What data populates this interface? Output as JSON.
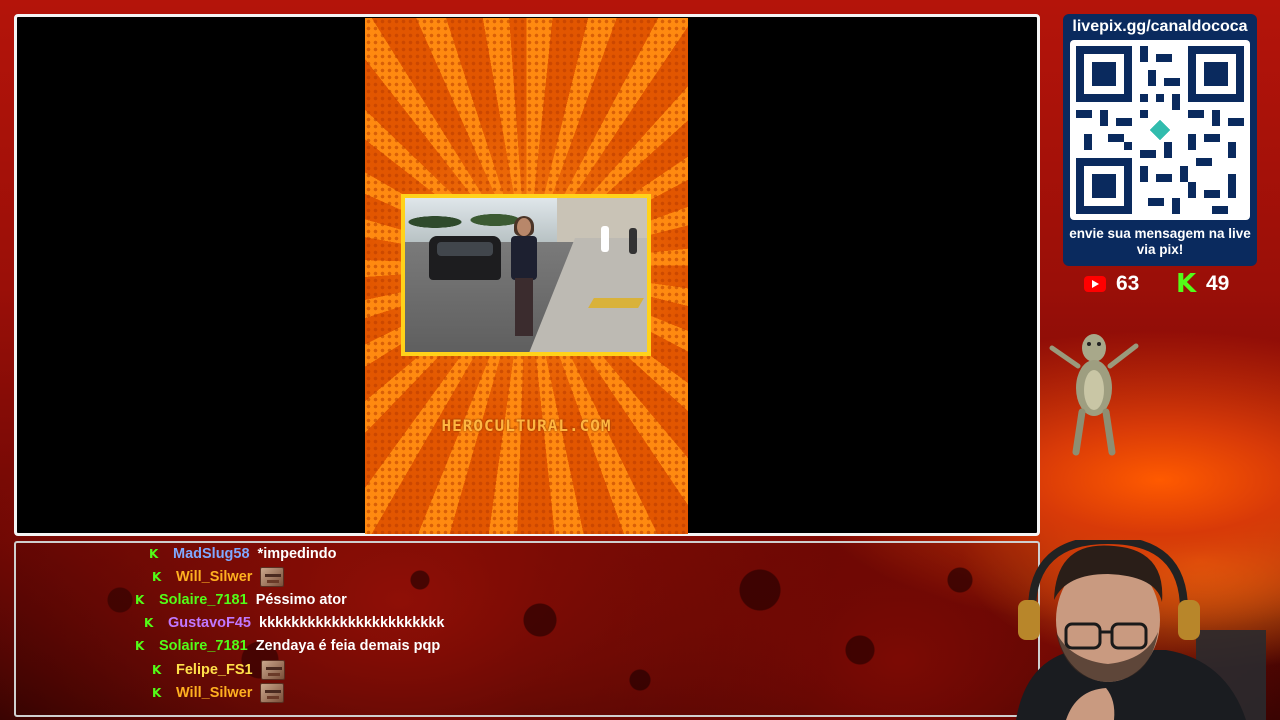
{
  "stream": {
    "watermark": "HEROCULTURAL.COM"
  },
  "pix": {
    "url": "livepix.gg/canaldococa",
    "caption": "envie sua mensagem na live via pix!"
  },
  "counters": {
    "youtube": "63",
    "kick": "49"
  },
  "colors": {
    "kick_green": "#53fc18",
    "youtube_red": "#ff0000",
    "pix_panel": "#0a2a5e"
  },
  "chat": {
    "messages": [
      {
        "platform": "kick",
        "user": "MadSlug58",
        "user_color": "#7fa8ff",
        "text": "*impedindo"
      },
      {
        "platform": "kick",
        "user": "Will_Silwer",
        "user_color": "#ffb020",
        "text": "",
        "emote": "face-emote"
      },
      {
        "platform": "kick",
        "user": "Solaire_7181",
        "user_color": "#53fc18",
        "text": "Péssimo ator"
      },
      {
        "platform": "kick",
        "user": "GustavoF45",
        "user_color": "#c078ff",
        "text": "kkkkkkkkkkkkkkkkkkkkkkk"
      },
      {
        "platform": "kick",
        "user": "Solaire_7181",
        "user_color": "#53fc18",
        "text": "Zendaya é feia demais pqp"
      },
      {
        "platform": "kick",
        "user": "Felipe_FS1",
        "user_color": "#ffe04a",
        "text": "",
        "emote": "face-emote"
      },
      {
        "platform": "kick",
        "user": "Will_Silwer",
        "user_color": "#ffb020",
        "text": "",
        "emote": "face-emote"
      }
    ]
  }
}
